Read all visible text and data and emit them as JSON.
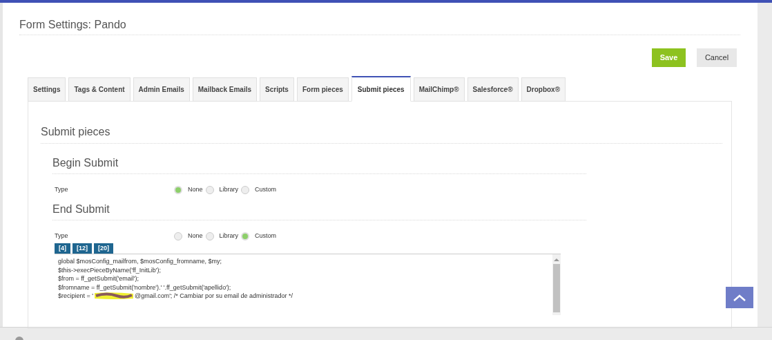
{
  "page": {
    "title": "Form Settings: Pando"
  },
  "actions": [
    {
      "label": "Save",
      "kind": "primary"
    },
    {
      "label": "Cancel",
      "kind": "secondary"
    }
  ],
  "tabs": [
    {
      "label": "Settings",
      "selected": false
    },
    {
      "label": "Tags & Content",
      "selected": false
    },
    {
      "label": "Admin Emails",
      "selected": false
    },
    {
      "label": "Mailback Emails",
      "selected": false
    },
    {
      "label": "Scripts",
      "selected": false
    },
    {
      "label": "Form pieces",
      "selected": false
    },
    {
      "label": "Submit pieces",
      "selected": true
    },
    {
      "label": "MailChimp®",
      "selected": false
    },
    {
      "label": "Salesforce®",
      "selected": false
    },
    {
      "label": "Dropbox®",
      "selected": false
    }
  ],
  "panel": {
    "title": "Submit pieces",
    "sections": [
      {
        "title": "Begin Submit",
        "type_label": "Type",
        "options": [
          {
            "label": "None",
            "selected": true
          },
          {
            "label": "Library",
            "selected": false
          },
          {
            "label": "Custom",
            "selected": false
          }
        ]
      },
      {
        "title": "End Submit",
        "type_label": "Type",
        "options": [
          {
            "label": "None",
            "selected": false
          },
          {
            "label": "Library",
            "selected": false
          },
          {
            "label": "Custom",
            "selected": true
          }
        ],
        "editor": {
          "tab_sizes": [
            "[4]",
            "[12]",
            "[20]"
          ],
          "lines": [
            {
              "text": "global $mosConfig_mailfrom, $mosConfig_fromname, $my;"
            },
            {
              "text": "$this->execPieceByName('ff_InitLib');"
            },
            {
              "text": "$from = ff_getSubmit('email');"
            },
            {
              "text": "$fromname = ff_getSubmit('nombre').' '.ff_getSubmit('apellido');"
            },
            {
              "text": "$recipient = '",
              "redacted": true,
              "after": "@gmail.com'; /* Cambiar por su email de administrador */"
            }
          ]
        }
      }
    ]
  }
}
